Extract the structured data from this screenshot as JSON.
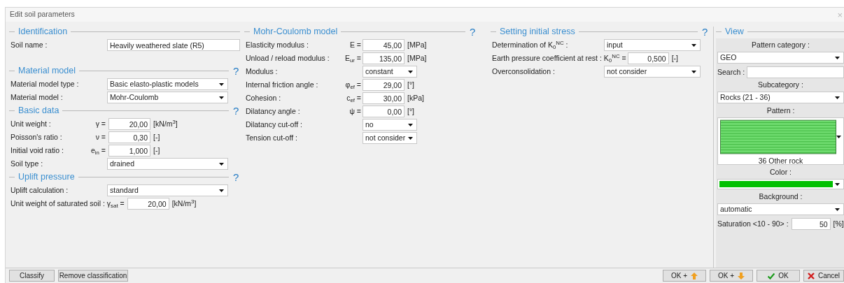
{
  "window": {
    "title": "Edit soil parameters",
    "close": "×"
  },
  "columns": [
    {
      "sections": [
        {
          "title": "Identification",
          "rows": [
            {
              "kind": "text",
              "label": "Soil name :",
              "value": "Heavily weathered slate (R5)"
            }
          ]
        },
        {
          "title": "Material model",
          "help": "?",
          "rows": [
            {
              "kind": "select",
              "label": "Material model type :",
              "value": "Basic elasto-plastic models"
            },
            {
              "kind": "select",
              "label": "Material model :",
              "value": "Mohr-Coulomb"
            }
          ]
        },
        {
          "title": "Basic data",
          "help": "?",
          "rows": [
            {
              "kind": "number",
              "label": "Unit weight :",
              "symbol": "γ =",
              "value": "20,00",
              "unit": "[kN/m$^{3}$]"
            },
            {
              "kind": "number",
              "label": "Poisson's ratio :",
              "symbol": "ν =",
              "value": "0,30",
              "unit": "[-]"
            },
            {
              "kind": "number",
              "label": "Initial void ratio :",
              "symbol": "e$_{in}$ =",
              "value": "1,000",
              "unit": "[-]"
            },
            {
              "kind": "select",
              "label": "Soil type :",
              "value": "drained"
            }
          ]
        },
        {
          "title": "Uplift pressure",
          "help": "?",
          "rows": [
            {
              "kind": "select",
              "label": "Uplift calculation :",
              "value": "standard"
            },
            {
              "kind": "number",
              "label": "Unit weight of saturated soil :",
              "symbol": "γ$_{sat}$ =",
              "value": "20,00",
              "unit": "[kN/m$^{3}$]"
            }
          ]
        }
      ]
    },
    {
      "sections": [
        {
          "title": "Mohr-Coulomb model",
          "help": "?",
          "rows": [
            {
              "kind": "number",
              "label": "Elasticity modulus :",
              "symbol": "E =",
              "value": "45,00",
              "unit": "[MPa]"
            },
            {
              "kind": "number",
              "label": "Unload / reload modulus :",
              "symbol": "E$_{ur}$ =",
              "value": "135,00",
              "unit": "[MPa]"
            },
            {
              "kind": "select",
              "label": "Modulus :",
              "value": "constant"
            },
            {
              "kind": "number",
              "label": "Internal friction angle :",
              "symbol": "φ$_{ef}$ =",
              "value": "29,00",
              "unit": "[°]"
            },
            {
              "kind": "number",
              "label": "Cohesion :",
              "symbol": "c$_{ef}$ =",
              "value": "30,00",
              "unit": "[kPa]"
            },
            {
              "kind": "number",
              "label": "Dilatancy angle :",
              "symbol": "ψ =",
              "value": "0,00",
              "unit": "[°]"
            },
            {
              "kind": "select",
              "label": "Dilatancy cut-off :",
              "value": "no"
            },
            {
              "kind": "select",
              "label": "Tension cut-off :",
              "value": "not consider"
            }
          ]
        }
      ]
    },
    {
      "sections": [
        {
          "title": "Setting initial stress",
          "help": "?",
          "rows": [
            {
              "kind": "select",
              "label": "Determination of K$_{0}$$^{NC}$ :",
              "value": "input"
            },
            {
              "kind": "number",
              "label": "Earth pressure coefficient at rest :",
              "symbol": "K$_{0}$$^{NC}$ =",
              "value": "0,500",
              "unit": "[-]"
            },
            {
              "kind": "select",
              "label": "Overconsolidation  :",
              "value": "not consider"
            }
          ]
        }
      ]
    }
  ],
  "view": {
    "title": "View",
    "items": [
      {
        "kind": "heading",
        "label": "Pattern category :"
      },
      {
        "kind": "select",
        "value": "GEO"
      },
      {
        "kind": "search",
        "label": "Search :"
      },
      {
        "kind": "heading",
        "label": "Subcategory :"
      },
      {
        "kind": "select",
        "value": "Rocks (21 - 36)"
      },
      {
        "kind": "heading",
        "label": "Pattern :"
      },
      {
        "kind": "pattern",
        "caption": "36 Other rock"
      },
      {
        "kind": "heading",
        "label": "Color :"
      },
      {
        "kind": "color",
        "color": "#00c000"
      },
      {
        "kind": "heading",
        "label": "Background :"
      },
      {
        "kind": "select",
        "value": "automatic"
      },
      {
        "kind": "number",
        "label": "Saturation <10 - 90> :",
        "value": "50",
        "unit": "[%]"
      }
    ]
  },
  "left_buttons": [
    {
      "label": "Classify"
    },
    {
      "label": "Remove classification"
    }
  ],
  "right_buttons": [
    {
      "label": "OK +",
      "kind": "up"
    },
    {
      "label": "OK +",
      "kind": "down"
    },
    {
      "label": "OK",
      "kind": "confirm"
    },
    {
      "label": "Cancel",
      "kind": "cancel"
    }
  ]
}
